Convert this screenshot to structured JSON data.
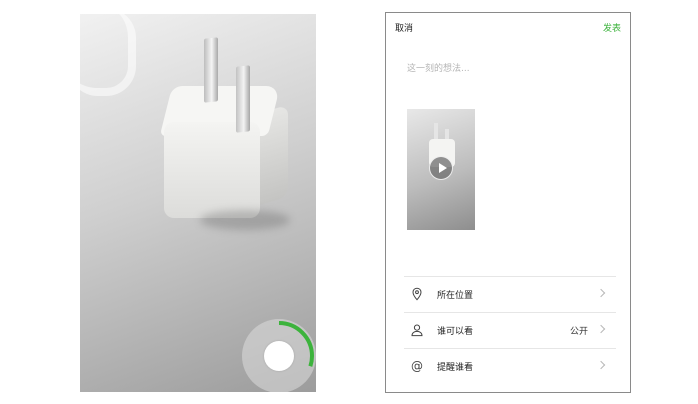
{
  "recording_screen": {
    "progress": 0.3
  },
  "publish_screen": {
    "header": {
      "cancel_label": "取消",
      "publish_label": "发表"
    },
    "thought_placeholder": "这一刻的想法...",
    "rows": [
      {
        "label": "所在位置",
        "value": "",
        "icon": "location-pin-icon"
      },
      {
        "label": "谁可以看",
        "value": "公开",
        "icon": "person-icon"
      },
      {
        "label": "提醒谁看",
        "value": "",
        "icon": "at-icon"
      }
    ],
    "colors": {
      "accent": "#3cb33c"
    }
  }
}
